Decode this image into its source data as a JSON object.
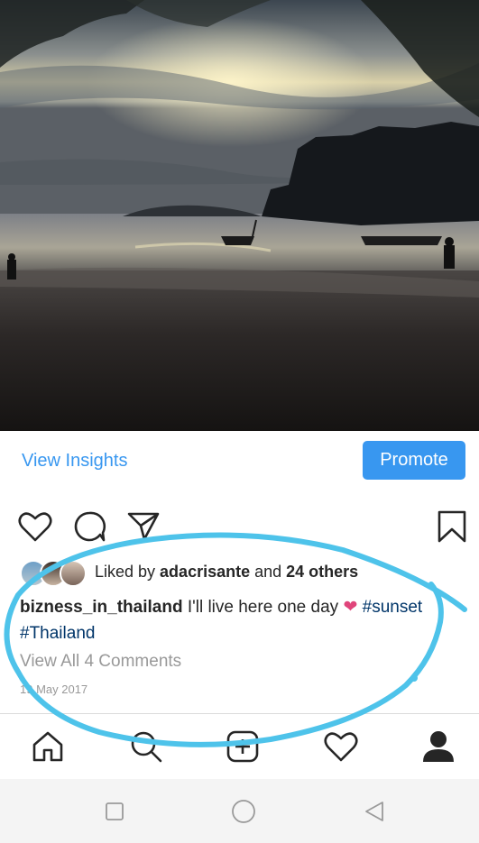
{
  "post": {
    "insights_label": "View Insights",
    "promote_label": "Promote",
    "likes": {
      "prefix": "Liked by ",
      "user": "adacrisante",
      "middle": " and ",
      "others": "24 others"
    },
    "caption": {
      "username": "bizness_in_thailand",
      "text": " I'll live here one day ",
      "emoji": "❤",
      "hashtag1": "#sunset",
      "hashtag2": "#Thailand"
    },
    "comments_link": "View All 4 Comments",
    "date": "19 May 2017"
  },
  "colors": {
    "accent": "#3897f0",
    "hashtag": "#003569",
    "muted": "#999999",
    "annotation": "#4ec3ea"
  },
  "icons": {
    "actions": [
      "heart-icon",
      "comment-icon",
      "share-icon",
      "bookmark-icon"
    ],
    "tabs": [
      "home-icon",
      "search-icon",
      "add-post-icon",
      "activity-icon",
      "profile-icon"
    ],
    "system": [
      "recents-icon",
      "home-circle-icon",
      "back-icon"
    ]
  }
}
